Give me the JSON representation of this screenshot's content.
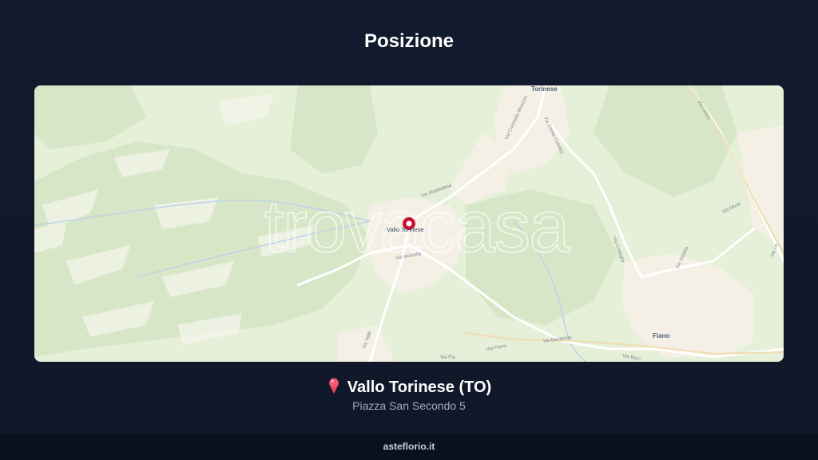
{
  "page": {
    "title": "Posizione"
  },
  "map": {
    "watermark": "trovacasa",
    "marker_label": "Vallo Torinese",
    "places": {
      "torinese": "Torinese",
      "fiano": "Fiano"
    },
    "streets": {
      "via_maddalena": "Via Maddalena",
      "via_gianetto": "Via Cosmetto Mosconi",
      "via_cresto_celebre": "Via Cresto Celebre",
      "via_lanzo": "Via Lanzo",
      "via_monti": "Via Monti",
      "via_corbiglia": "Via Corbiglia",
      "via_vialatta": "Via Vialatta",
      "via_san_secondo": "Via Varisella",
      "via_baratonia": "Via Baratonia",
      "via_fiano": "Via Fiano",
      "via_varisella": "Via Valle",
      "via_le": "Via Le",
      "via_fia": "Via Fia",
      "via_baro": "Via Baro"
    }
  },
  "location": {
    "name": "Vallo Torinese (TO)",
    "address": "Piazza San Secondo 5"
  },
  "footer": {
    "site": "asteflorio.it"
  },
  "colors": {
    "background": "#111a2d",
    "map_land": "#e6efd8",
    "map_forest": "#d3e3c3",
    "map_urban": "#f5f0e6",
    "marker": "#c8102e"
  }
}
